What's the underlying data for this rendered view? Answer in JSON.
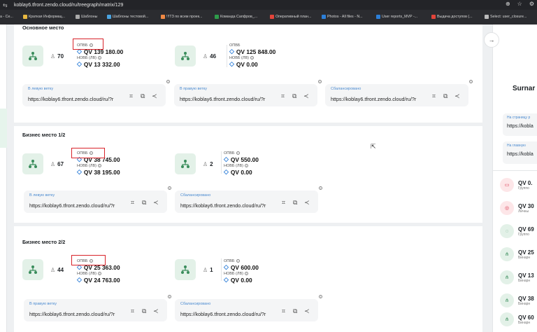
{
  "browser": {
    "url": "koblay6.tfront.zendo.cloud/ru/treegraph/matrix/129"
  },
  "bookmarks": [
    {
      "label": "а - Се...",
      "color": "#888"
    },
    {
      "label": "Краткая Информац...",
      "color": "#e8b840"
    },
    {
      "label": "Шаблоны",
      "color": "#aaa"
    },
    {
      "label": "Шаблоны тестовой...",
      "color": "#4aa3df"
    },
    {
      "label": "!!!ТЗ по всем проек...",
      "color": "#e84"
    },
    {
      "label": "Команда Сапфров_...",
      "color": "#2e9b4a"
    },
    {
      "label": "Оперативный план...",
      "color": "#e2443a"
    },
    {
      "label": "Photos - All files - N...",
      "color": "#2c7fd8"
    },
    {
      "label": "User reports_MVP -...",
      "color": "#2c7fd8"
    },
    {
      "label": "Выдача доступов (...",
      "color": "#e2443a"
    },
    {
      "label": "Select: user_closure...",
      "color": "#bbb"
    }
  ],
  "labels": {
    "opvb": "ОПВБ",
    "novb": "НОВБ (ЛВ)",
    "left_branch": "В левую ветку",
    "right_branch": "В правую ветку",
    "balanced": "Сбалансировано"
  },
  "link_url": "https://koblay6.tfront.zendo.cloud/ru/?r",
  "sections": [
    {
      "title": "Основное место",
      "left": {
        "count": "70",
        "opvb": "QV 139 180.00",
        "novb": "QV 13 332.00"
      },
      "right": {
        "count": "46",
        "opvb": "QV 125 848.00",
        "novb": "QV 0.00"
      }
    },
    {
      "title": "Бизнес место 1/2",
      "left": {
        "count": "67",
        "opvb": "QV 38 745.00",
        "novb": "QV 38 195.00"
      },
      "right": {
        "count": "2",
        "opvb": "QV 550.00",
        "novb": "QV 0.00"
      }
    },
    {
      "title": "Бизнес место 2/2",
      "left": {
        "count": "44",
        "opvb": "QV 25 363.00",
        "novb": "QV 24 763.00"
      },
      "right": {
        "count": "1",
        "opvb": "QV 600.00",
        "novb": "QV 0.00"
      }
    }
  ],
  "right_panel": {
    "name": "Surnar",
    "link1_label": "На страницу р",
    "link1_url": "https://kobla",
    "link2_label": "На главную",
    "link2_url": "https://kobla",
    "items": [
      {
        "value": "QV 0.",
        "sub": "Группо",
        "bg": "#fde6e8",
        "fg": "#d9334a",
        "icon": "▭"
      },
      {
        "value": "QV 30",
        "sub": "Личны",
        "bg": "#fde6e8",
        "fg": "#d9334a",
        "icon": "◎"
      },
      {
        "value": "QV 69",
        "sub": "Группо",
        "bg": "#e3f1e8",
        "fg": "#3a8d5b",
        "icon": "◌"
      },
      {
        "value": "QV 25",
        "sub": "Бинарн",
        "bg": "#e3f1e8",
        "fg": "#3a8d5b",
        "icon": "⋔"
      },
      {
        "value": "QV 13",
        "sub": "Бинарн",
        "bg": "#e3f1e8",
        "fg": "#3a8d5b",
        "icon": "⋔"
      },
      {
        "value": "QV 38",
        "sub": "Бинарн",
        "bg": "#e3f1e8",
        "fg": "#3a8d5b",
        "icon": "⋔"
      },
      {
        "value": "QV 60",
        "sub": "Бинарн",
        "bg": "#e3f1e8",
        "fg": "#3a8d5b",
        "icon": "⋔"
      }
    ]
  }
}
